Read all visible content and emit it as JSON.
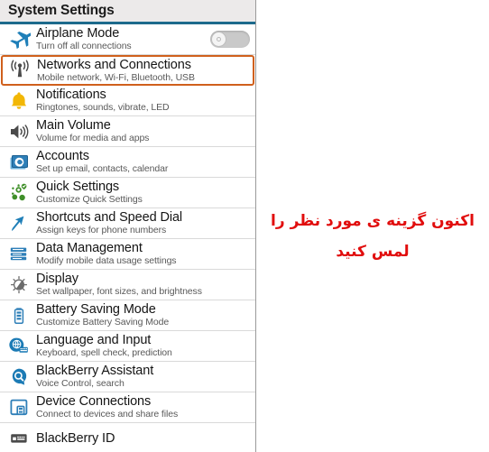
{
  "header": {
    "title": "System Settings",
    "accent_color": "#1d6a8c",
    "background_color": "#eceaea"
  },
  "selection": {
    "highlight_color": "#d0601c",
    "selected_item": "Networks and Connections"
  },
  "instruction": {
    "line1": "اکنون گزینه ی مورد نظر را",
    "line2": "لمس کنید",
    "color": "#e10d0d"
  },
  "list": {
    "items": [
      {
        "title": "Airplane Mode",
        "subtitle": "Turn off all connections",
        "icon": "airplane-icon",
        "selected": false,
        "control": "toggle",
        "toggle_state": "off"
      },
      {
        "title": "Networks and Connections",
        "subtitle": "Mobile network, Wi-Fi, Bluetooth, USB",
        "icon": "antenna-signal-icon",
        "selected": true,
        "control": "none"
      },
      {
        "title": "Notifications",
        "subtitle": "Ringtones, sounds, vibrate, LED",
        "icon": "bell-icon",
        "selected": false,
        "control": "none"
      },
      {
        "title": "Main Volume",
        "subtitle": "Volume for media and apps",
        "icon": "speaker-icon",
        "selected": false,
        "control": "none"
      },
      {
        "title": "Accounts",
        "subtitle": "Set up email, contacts, calendar",
        "icon": "at-sign-card-icon",
        "selected": false,
        "control": "none"
      },
      {
        "title": "Quick Settings",
        "subtitle": "Customize Quick Settings",
        "icon": "quick-settings-nodes-icon",
        "selected": false,
        "control": "none"
      },
      {
        "title": "Shortcuts and Speed Dial",
        "subtitle": "Assign keys for phone numbers",
        "icon": "arrow-shortcut-icon",
        "selected": false,
        "control": "none"
      },
      {
        "title": "Data Management",
        "subtitle": "Modify mobile data usage settings",
        "icon": "data-server-icon",
        "selected": false,
        "control": "none"
      },
      {
        "title": "Display",
        "subtitle": "Set wallpaper, font sizes, and brightness",
        "icon": "brightness-icon",
        "selected": false,
        "control": "none"
      },
      {
        "title": "Battery Saving Mode",
        "subtitle": "Customize Battery Saving Mode",
        "icon": "battery-icon",
        "selected": false,
        "control": "none"
      },
      {
        "title": "Language and Input",
        "subtitle": "Keyboard, spell check, prediction",
        "icon": "globe-keyboard-icon",
        "selected": false,
        "control": "none"
      },
      {
        "title": "BlackBerry Assistant",
        "subtitle": "Voice Control, search",
        "icon": "assistant-search-icon",
        "selected": false,
        "control": "none"
      },
      {
        "title": "Device Connections",
        "subtitle": "Connect to devices and share files",
        "icon": "device-share-icon",
        "selected": false,
        "control": "none"
      },
      {
        "title": "BlackBerry ID",
        "subtitle": "",
        "icon": "id-card-icon",
        "selected": false,
        "control": "none"
      }
    ]
  }
}
